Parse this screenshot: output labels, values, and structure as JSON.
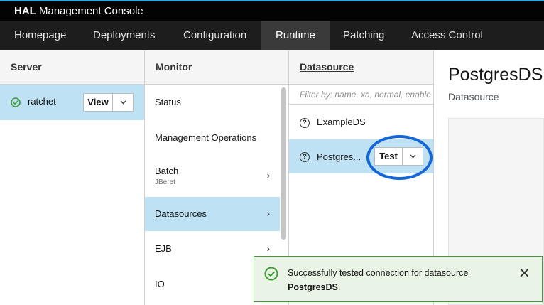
{
  "app": {
    "brand_bold": "HAL",
    "brand_rest": " Management Console"
  },
  "nav": {
    "items": [
      "Homepage",
      "Deployments",
      "Configuration",
      "Runtime",
      "Patching",
      "Access Control"
    ],
    "active": "Runtime"
  },
  "server_column": {
    "header": "Server",
    "items": [
      {
        "name": "ratchet",
        "status": "ok",
        "action": "View"
      }
    ]
  },
  "monitor_column": {
    "header": "Monitor",
    "items": [
      {
        "label": "Status",
        "sub": ""
      },
      {
        "label": "Management Operations",
        "sub": ""
      },
      {
        "label": "Batch",
        "sub": "JBeret"
      },
      {
        "label": "Datasources",
        "sub": ""
      },
      {
        "label": "EJB",
        "sub": ""
      },
      {
        "label": "IO",
        "sub": ""
      }
    ],
    "selected": "Datasources"
  },
  "datasource_column": {
    "header": "Datasource",
    "filter_placeholder": "Filter by: name, xa, normal, enable",
    "items": [
      {
        "name": "ExampleDS",
        "icon": "question-circle-icon"
      },
      {
        "name": "Postgres...",
        "icon": "question-circle-icon",
        "action": "Test"
      }
    ]
  },
  "detail": {
    "title": "PostgresDS",
    "subtitle": "Datasource"
  },
  "toast": {
    "type": "success",
    "message": "Successfully tested connection for datasource",
    "target": "PostgresDS",
    "suffix": "."
  },
  "colors": {
    "selected_bg": "#bee1f4",
    "nav_bg": "#1d1d1d",
    "success_border": "#3f9c35",
    "success_bg": "#e9f4e6",
    "highlight": "#1465d6"
  }
}
